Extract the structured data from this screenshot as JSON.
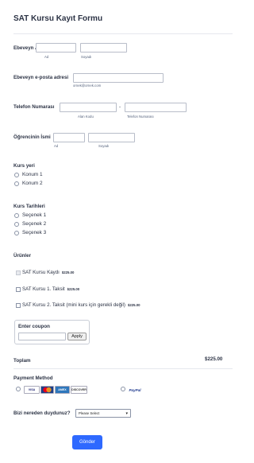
{
  "form": {
    "title": "SAT Kursu Kayıt Formu"
  },
  "parent_name": {
    "label": "Ebeveyn Adı",
    "first_sub": "Ad",
    "last_sub": "Soyadı"
  },
  "parent_email": {
    "label": "Ebeveyn e-posta adresi",
    "hint": "ornek@ornek.com"
  },
  "phone": {
    "label": "Telefon Numarası",
    "area_sub": "Alan Kodu",
    "number_sub": "Telefon Numarası",
    "separator": "-"
  },
  "student_name": {
    "label": "Öğrencinin İsmi",
    "first_sub": "Ad",
    "last_sub": "Soyadı"
  },
  "location": {
    "label": "Kurs yeri",
    "options": [
      "Konum 1",
      "Konum 2"
    ]
  },
  "dates": {
    "label": "Kurs Tarihleri",
    "options": [
      "Seçenek 1",
      "Seçenek 2",
      "Seçenek 3"
    ]
  },
  "products": {
    "label": "Ürünler",
    "items": [
      {
        "name": "SAT Kursu Kaydı",
        "price": "$225.00",
        "disabled": true
      },
      {
        "name": "SAT Kursu 1. Taksit",
        "price": "$225.00",
        "disabled": false
      },
      {
        "name": "SAT Kursu 2. Taksit (mini kurs için gerekli değil)",
        "price": "$225.00",
        "disabled": false
      }
    ]
  },
  "coupon": {
    "label": "Enter coupon",
    "apply_label": "Apply"
  },
  "total": {
    "label": "Toplam",
    "value": "$225.00"
  },
  "payment": {
    "label": "Payment Method",
    "cards": [
      "VISA",
      "MC",
      "AMEX",
      "DISCOVER"
    ],
    "paypal": "PayPal"
  },
  "referral": {
    "label": "Bizi nereden duydunuz?",
    "selected": "Please Select"
  },
  "submit": {
    "label": "Gönder"
  },
  "colors": {
    "accent": "#2e69ff",
    "text": "#2c3345"
  }
}
